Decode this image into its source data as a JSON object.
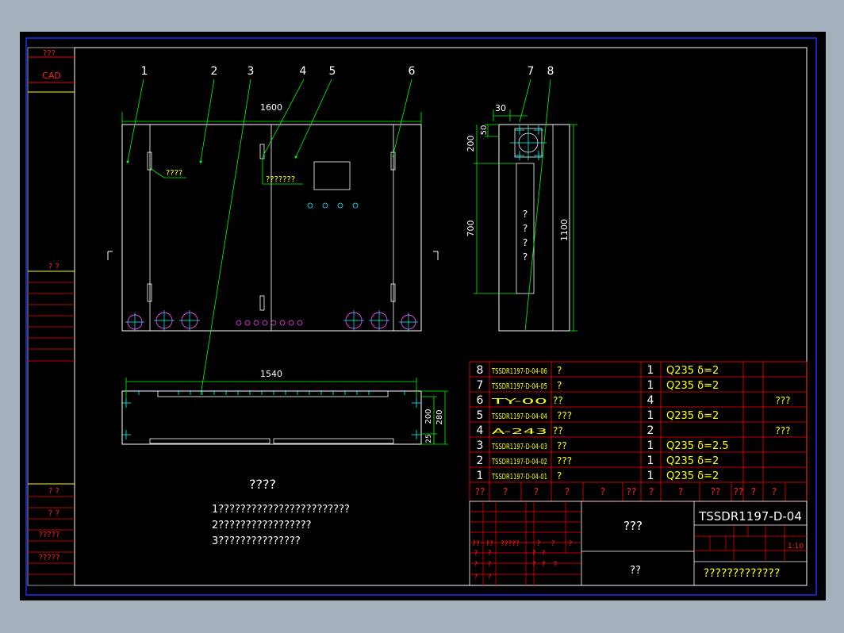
{
  "left_strip": {
    "label_top": "???",
    "label_cad": "CAD",
    "label_mid": "?  ?",
    "label_low1": "?  ?",
    "label_low2": "?  ?",
    "label_low3": "?????",
    "label_low4": "?????"
  },
  "front_view": {
    "dim_width": "1600",
    "balloons": [
      "1",
      "2",
      "3",
      "4",
      "5",
      "6"
    ],
    "note_a": "????",
    "note_b": "???????"
  },
  "side_view": {
    "balloons": [
      "7",
      "8"
    ],
    "dim_30": "30",
    "dim_50": "50",
    "dim_200": "200",
    "dim_700": "700",
    "dim_1100": "1100",
    "vertical_text": [
      "?",
      "?",
      "?",
      "?"
    ]
  },
  "top_view": {
    "dim_width": "1540",
    "dim_200": "200",
    "dim_280": "280",
    "dim_25": "25"
  },
  "notes": {
    "title": "????",
    "lines": [
      "1????????????????????????",
      "2?????????????????",
      "3???????????????"
    ]
  },
  "bom": {
    "rows": [
      {
        "no": "8",
        "code": "TSSDR1197-D-04-06",
        "name": "?",
        "qty": "1",
        "mat": "Q235  δ=2",
        "note": ""
      },
      {
        "no": "7",
        "code": "TSSDR1197-D-04-05",
        "name": "?",
        "qty": "1",
        "mat": "Q235  δ=2",
        "note": ""
      },
      {
        "no": "6",
        "code": "TY-00",
        "name": "??",
        "qty": "4",
        "mat": "",
        "note": "???"
      },
      {
        "no": "5",
        "code": "TSSDR1197-D-04-04",
        "name": "???",
        "qty": "1",
        "mat": "Q235  δ=2",
        "note": ""
      },
      {
        "no": "4",
        "code": "A-243",
        "name": "??",
        "qty": "2",
        "mat": "",
        "note": "???"
      },
      {
        "no": "3",
        "code": "TSSDR1197-D-04-03",
        "name": "??",
        "qty": "1",
        "mat": "Q235  δ=2.5",
        "note": ""
      },
      {
        "no": "2",
        "code": "TSSDR1197-D-04-02",
        "name": "???",
        "qty": "1",
        "mat": "Q235  δ=2",
        "note": ""
      },
      {
        "no": "1",
        "code": "TSSDR1197-D-04-01",
        "name": "?",
        "qty": "1",
        "mat": "Q235  δ=2",
        "note": ""
      }
    ],
    "header": [
      "??",
      "?",
      "?",
      "?",
      "?",
      "??",
      "?",
      "?",
      "??",
      "??",
      "?",
      "?"
    ]
  },
  "title_block": {
    "drawing_no": "TSSDR1197-D-04",
    "part_name": "???",
    "material_label": "??",
    "company": "?????????????",
    "scale": "1:10",
    "small_labels": [
      "??",
      "??",
      "?????",
      "?",
      "?",
      "?",
      "?",
      "?",
      "?",
      "?",
      "?",
      "?",
      "?",
      "?",
      "?",
      "?",
      "?"
    ]
  },
  "colors": {
    "background": "#000000",
    "frame": "#1f2fff",
    "geometry": "#ffffff",
    "dimension": "#00ff00",
    "text": "#ffff00",
    "table_line": "#ff0000",
    "red_text": "#ff2020",
    "center_marks": "#00ffff",
    "circles": "#ff44ff"
  }
}
